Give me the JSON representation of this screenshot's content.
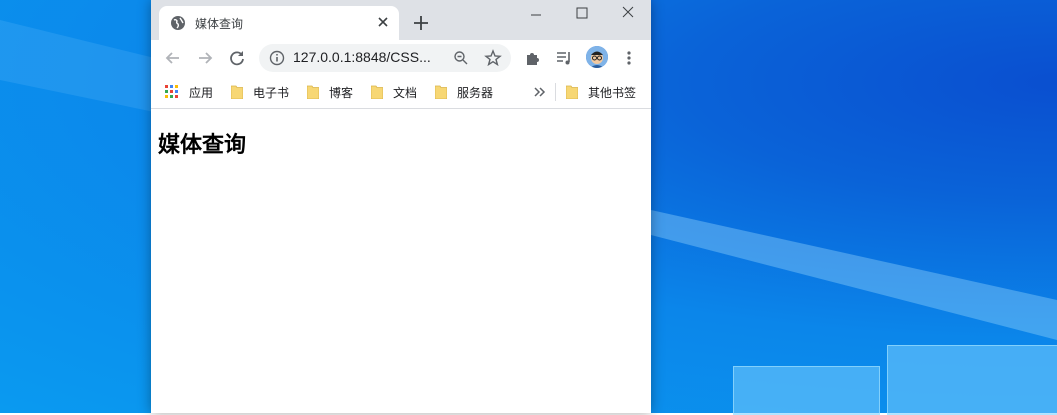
{
  "browser": {
    "tab": {
      "title": "媒体查询"
    },
    "address_bar": {
      "url": "127.0.0.1:8848/CSS..."
    },
    "bookmarks": [
      {
        "label": "应用"
      },
      {
        "label": "电子书"
      },
      {
        "label": "博客"
      },
      {
        "label": "文档"
      },
      {
        "label": "服务器"
      }
    ],
    "other_bookmarks": "其他书签"
  },
  "page": {
    "heading": "媒体查询"
  },
  "icons": [
    "globe-icon",
    "close-icon",
    "plus-icon",
    "minimize-icon",
    "maximize-icon",
    "window-close-icon",
    "back-icon",
    "forward-icon",
    "reload-icon",
    "info-icon",
    "zoom-icon",
    "star-icon",
    "extensions-icon",
    "media-icon",
    "avatar",
    "more-icon",
    "apps-icon",
    "folder-icon",
    "chevron-double-right-icon"
  ],
  "colors": {
    "desktop": "#0a86ea",
    "tabstrip": "#dee1e6",
    "omnibox": "#f1f3f4"
  }
}
